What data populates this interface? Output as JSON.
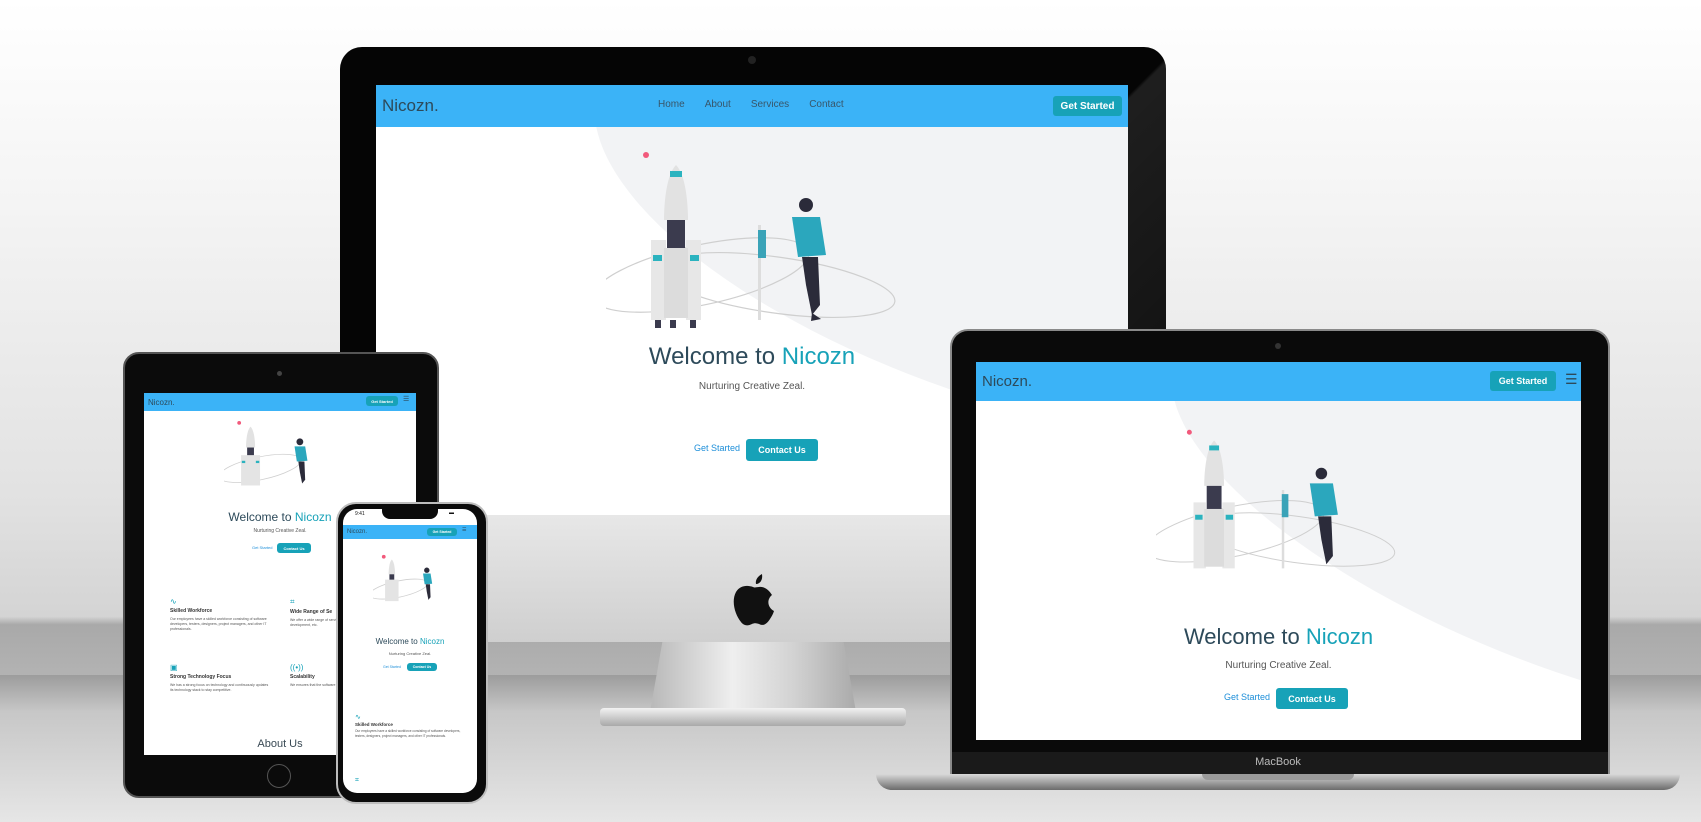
{
  "site": {
    "brand": "Nicozn.",
    "nav": [
      "Home",
      "About",
      "Services",
      "Contact"
    ],
    "cta": "Get Started",
    "hero": {
      "welcome": "Welcome to",
      "name": "Nicozn",
      "tagline": "Nurturing Creative Zeal.",
      "link": "Get Started",
      "button": "Contact Us"
    },
    "features": [
      {
        "title": "Skilled Workforce",
        "text": "Our employees have a skilled workforce consisting of software developers, testers, designers, project managers, and other IT professionals."
      },
      {
        "title": "Wide Range of Se",
        "text": "We offer a wide range of services, development, web development, etc."
      },
      {
        "title": "Strong Technology Focus",
        "text": "We has a strong focus on technology and continuously updates its technology stack to stay competitive."
      },
      {
        "title": "Scalability",
        "text": "We ensures that the software handle large amounts of da"
      }
    ],
    "about_heading": "About Us"
  },
  "devices": {
    "laptop_label": "MacBook",
    "phone_time": "9:41"
  },
  "colors": {
    "nav": "#3bb3f7",
    "accent": "#17a2b8",
    "link": "#1e8fd9",
    "title": "#2d4a5a"
  }
}
